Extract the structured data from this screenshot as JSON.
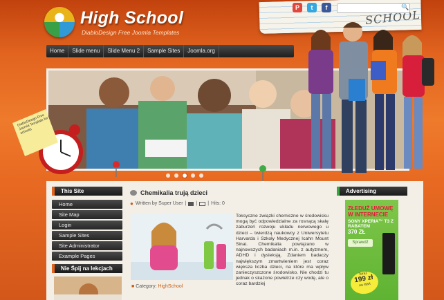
{
  "header": {
    "title": "High School",
    "tagline": "DiabloDesign Free Joomla Templates",
    "scribble": "SCHOOL",
    "social": [
      "P",
      "t",
      "f"
    ]
  },
  "nav": {
    "items": [
      "Home",
      "Slide menu",
      "Slide Menu 2",
      "Sample Sites",
      "Joomla.org"
    ]
  },
  "colors": {
    "accent": "#e2641f",
    "dark_bar": "#1e1e1e",
    "link": "#c75b12"
  },
  "sidebar": {
    "this_site_title": "This Site",
    "this_site_items": [
      "Home",
      "Site Map",
      "Login",
      "Sample Sites",
      "Site Administrator",
      "Example Pages"
    ],
    "second_title": "Nie Śpij na lekcjach"
  },
  "article": {
    "title": "Chemikalia trują dzieci",
    "written_by": "Written by Super User",
    "hits": "Hits: 0",
    "body": "Toksyczne związki chemiczne w środowisku mogą być odpowiedzialne za rosnącą skalę zaburzeń rozwoju układu nerwowego u dzieci – twierdzą naukowcy z Uniwersytetu Harvarda i Szkoły Medycznej Icahn Mount Sinai. Chemikalia powiązano w najnowszych badaniach m.in. z autyzmem, ADHD i dysleksją. Zdaniem badaczy największym zmartwieniem jest coraz większa liczba dzieci, na które ma wpływ zanieczyszczone środowisko. Nie chodzi tu jednak o skażone powietrze czy wodę, ale o coraz bardziej",
    "category_label": "Category:",
    "category": "HighSchool"
  },
  "advertising": {
    "title": "Advertising",
    "line1": "ZŁEDUŻ UMOWĘ W INTERNECIE",
    "line2": "SONY XPERIA™ T3 Z RABATEM",
    "line3": "370 ZŁ",
    "button": "Sprawdź",
    "price_label": "Teraz",
    "price": "199 zł",
    "price_note": "na start"
  },
  "note_text": "DiabloDesign Free Joomla Template for schools"
}
